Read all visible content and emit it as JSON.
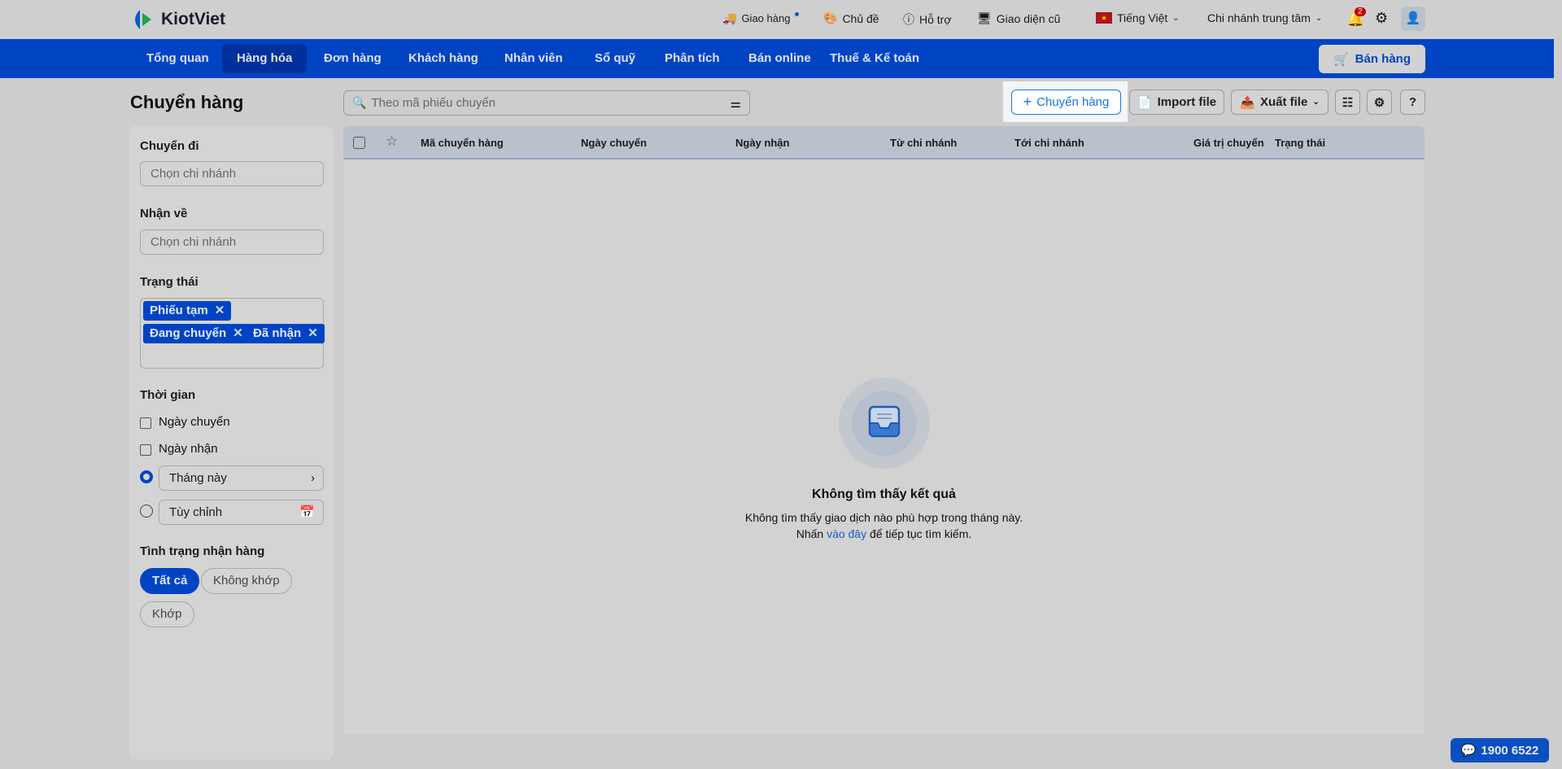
{
  "brand": {
    "name": "KiotViet"
  },
  "topbar": {
    "delivery": "Giao hàng",
    "theme": "Chủ đề",
    "support": "Hỗ trợ",
    "old_ui": "Giao diện cũ",
    "language": "Tiếng Việt",
    "branch": "Chi nhánh trung tâm",
    "notification_count": "2"
  },
  "nav": {
    "items": [
      "Tổng quan",
      "Hàng hóa",
      "Đơn hàng",
      "Khách hàng",
      "Nhân viên",
      "Sổ quỹ",
      "Phân tích",
      "Bán online",
      "Thuế & Kế toán"
    ],
    "sell_button": "Bán hàng"
  },
  "page": {
    "title": "Chuyển hàng",
    "search_placeholder": "Theo mã phiếu chuyển",
    "add_button": "Chuyển hàng",
    "import_button": "Import file",
    "export_button": "Xuất file"
  },
  "filters": {
    "from_label": "Chuyển đi",
    "from_placeholder": "Chọn chi nhánh",
    "to_label": "Nhận về",
    "to_placeholder": "Chọn chi nhánh",
    "status_label": "Trạng thái",
    "status_tags": [
      "Phiếu tạm",
      "Đang chuyển",
      "Đã nhận"
    ],
    "time_label": "Thời gian",
    "date_transfer": "Ngày chuyển",
    "date_receive": "Ngày nhận",
    "this_month": "Tháng này",
    "custom": "Tùy chỉnh",
    "receive_status_label": "Tình trạng nhận hàng",
    "receive_options": [
      "Tất cả",
      "Không khớp",
      "Khớp"
    ]
  },
  "table": {
    "columns": [
      "Mã chuyển hàng",
      "Ngày chuyển",
      "Ngày nhận",
      "Từ chi nhánh",
      "Tới chi nhánh",
      "Giá trị chuyển",
      "Trạng thái"
    ]
  },
  "empty": {
    "title": "Không tìm thấy kết quả",
    "line1": "Không tìm thấy giao dịch nào phù hợp trong tháng này.",
    "line2_prefix": "Nhấn",
    "line2_link": "vào đây",
    "line2_suffix": "để tiếp tục tìm kiếm."
  },
  "hotline": "1900 6522",
  "colors": {
    "primary": "#0044c4",
    "accent": "#1a73e8"
  }
}
